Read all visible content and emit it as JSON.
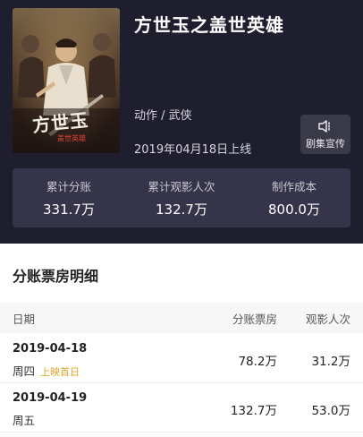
{
  "movie": {
    "title": "方世玉之盖世英雄",
    "genre": "动作 / 武侠",
    "release": "2019年04月18日上线",
    "poster_text": "方世玉",
    "poster_subtext": "盖世英雄",
    "promo_label": "剧集宣传",
    "promo_icon": "speaker-icon"
  },
  "stats": [
    {
      "label": "累计分账",
      "value": "331.7万"
    },
    {
      "label": "累计观影人次",
      "value": "132.7万"
    },
    {
      "label": "制作成本",
      "value": "800.0万"
    }
  ],
  "section": {
    "title": "分账票房明细",
    "columns": {
      "date": "日期",
      "box": "分账票房",
      "audience": "观影人次"
    }
  },
  "rows": [
    {
      "date": "2019-04-18",
      "weekday": "周四",
      "tag": "上映首日",
      "box": "78.2万",
      "audience": "31.2万"
    },
    {
      "date": "2019-04-19",
      "weekday": "周五",
      "tag": "",
      "box": "132.7万",
      "audience": "53.0万"
    }
  ],
  "colors": {
    "hero_bg": "#1f1e2e",
    "stat_bg": "#35344a",
    "tag": "#e0a42a"
  }
}
